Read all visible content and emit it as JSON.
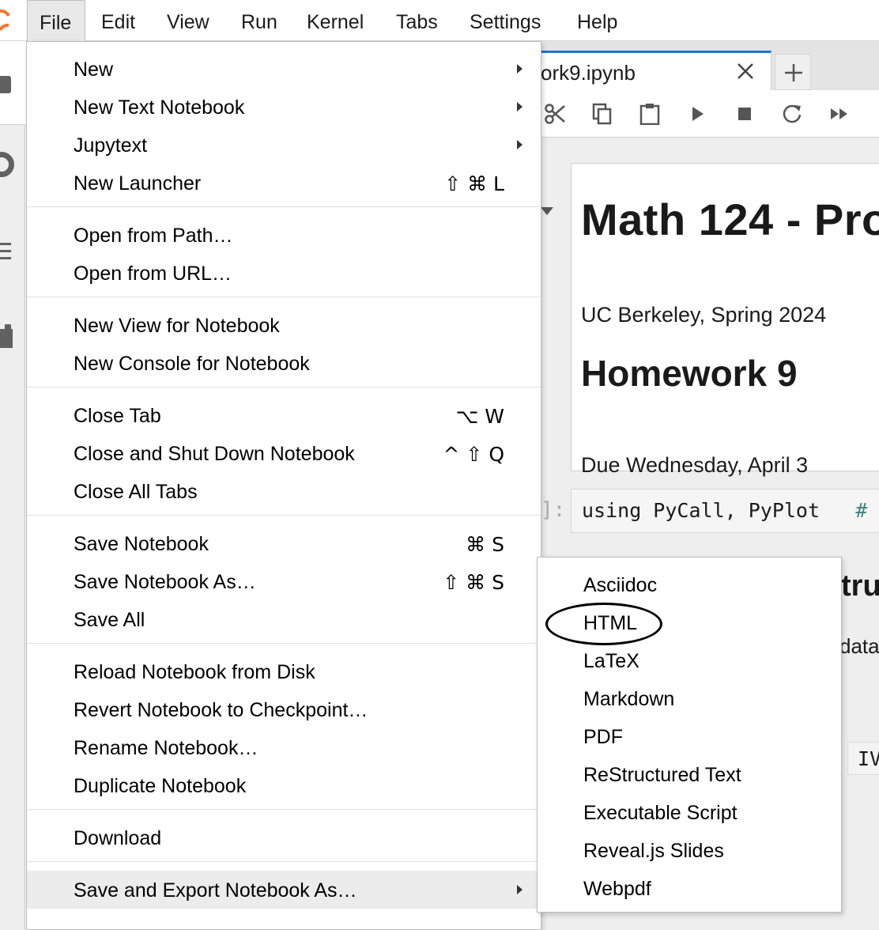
{
  "menubar": {
    "items": [
      "File",
      "Edit",
      "View",
      "Run",
      "Kernel",
      "Tabs",
      "Settings",
      "Help"
    ]
  },
  "tab": {
    "label": "ork9.ipynb"
  },
  "toolbar": {
    "icons": [
      "cut-icon",
      "copy-icon",
      "paste-icon",
      "run-icon",
      "stop-icon",
      "restart-icon",
      "fast-forward-icon"
    ]
  },
  "notebook": {
    "title": "Math 124 - Pro",
    "subtitle": "UC Berkeley, Spring 2024",
    "heading": "Homework 9",
    "due": "Due Wednesday, April 3",
    "prompt": "]:",
    "code": "using PyCall, PyPlot",
    "code_comment": "#",
    "frag_heading": "tru",
    "frag_text": "data",
    "frag_code": "IV"
  },
  "file_menu": {
    "items": [
      {
        "label": "New",
        "shortcut": "",
        "submenu": true
      },
      {
        "label": "New Text Notebook",
        "shortcut": "",
        "submenu": true
      },
      {
        "label": "Jupytext",
        "shortcut": "",
        "submenu": true
      },
      {
        "label": "New Launcher",
        "shortcut": "⇧ ⌘ L",
        "submenu": false
      },
      {
        "label": "Open from Path…",
        "shortcut": "",
        "submenu": false
      },
      {
        "label": "Open from URL…",
        "shortcut": "",
        "submenu": false
      },
      {
        "label": "New View for Notebook",
        "shortcut": "",
        "submenu": false
      },
      {
        "label": "New Console for Notebook",
        "shortcut": "",
        "submenu": false
      },
      {
        "label": "Close Tab",
        "shortcut": "⌥ W",
        "submenu": false
      },
      {
        "label": "Close and Shut Down Notebook",
        "shortcut": "^ ⇧ Q",
        "submenu": false
      },
      {
        "label": "Close All Tabs",
        "shortcut": "",
        "submenu": false
      },
      {
        "label": "Save Notebook",
        "shortcut": "⌘ S",
        "submenu": false
      },
      {
        "label": "Save Notebook As…",
        "shortcut": "⇧ ⌘ S",
        "submenu": false
      },
      {
        "label": "Save All",
        "shortcut": "",
        "submenu": false
      },
      {
        "label": "Reload Notebook from Disk",
        "shortcut": "",
        "submenu": false
      },
      {
        "label": "Revert Notebook to Checkpoint…",
        "shortcut": "",
        "submenu": false
      },
      {
        "label": "Rename Notebook…",
        "shortcut": "",
        "submenu": false
      },
      {
        "label": "Duplicate Notebook",
        "shortcut": "",
        "submenu": false
      },
      {
        "label": "Download",
        "shortcut": "",
        "submenu": false
      },
      {
        "label": "Save and Export Notebook As…",
        "shortcut": "",
        "submenu": true
      }
    ]
  },
  "export_submenu": {
    "items": [
      "Asciidoc",
      "HTML",
      "LaTeX",
      "Markdown",
      "PDF",
      "ReStructured Text",
      "Executable Script",
      "Reveal.js Slides",
      "Webpdf"
    ],
    "highlighted": "HTML"
  },
  "colors": {
    "accent": "#1976d2",
    "logo": "#f37726",
    "menu_hover": "#ececec"
  }
}
